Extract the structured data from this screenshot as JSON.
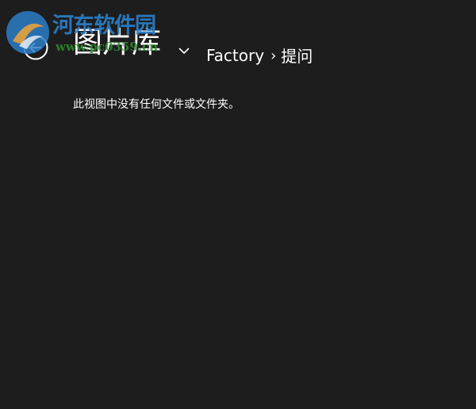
{
  "watermark": {
    "title": "河东软件园",
    "url": "www.pc0359.cn"
  },
  "header": {
    "title": "图片库",
    "breadcrumb": {
      "items": [
        "Factory",
        "提问"
      ],
      "separator": "›"
    },
    "icons": {
      "back": "back-arrow-circle-icon",
      "dropdown": "chevron-down-icon"
    }
  },
  "main": {
    "empty_message": "此视图中没有任何文件或文件夹。"
  },
  "colors": {
    "background": "#1d1d1d",
    "text": "#ffffff",
    "watermark_blue": "#2b7ec8",
    "watermark_green": "#2e8f2e"
  }
}
